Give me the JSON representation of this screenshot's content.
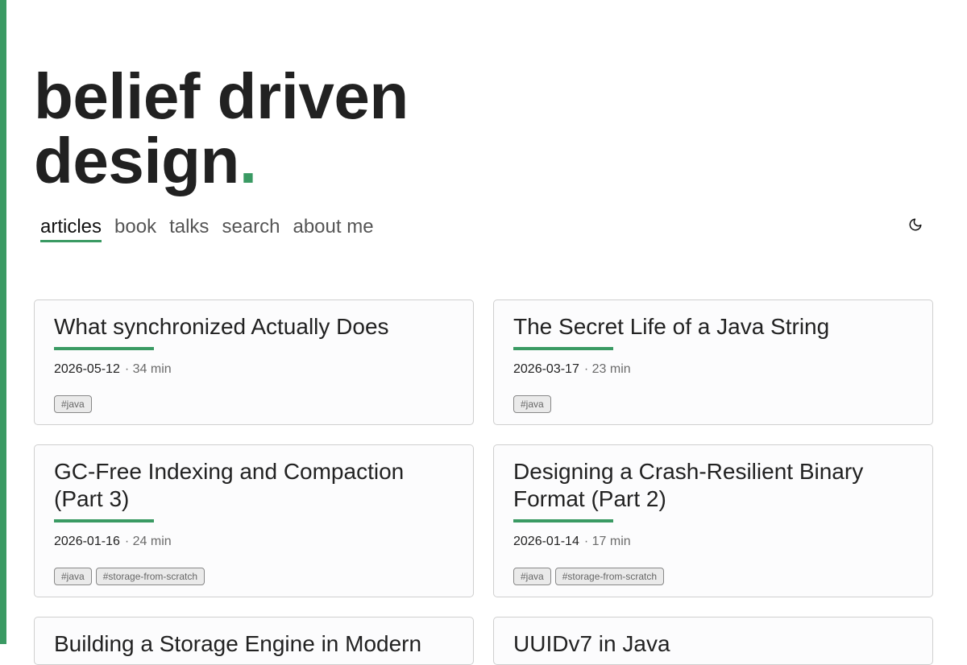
{
  "site": {
    "title_line1": "belief driven",
    "title_line2": "design",
    "title_dot": ".",
    "accent_color": "#3a9a63"
  },
  "nav": {
    "items": [
      {
        "label": "articles",
        "active": true
      },
      {
        "label": "book"
      },
      {
        "label": "talks"
      },
      {
        "label": "search"
      },
      {
        "label": "about me"
      }
    ],
    "theme_toggle_icon": "moon-icon"
  },
  "articles": [
    {
      "title": "What synchronized Actually Does",
      "date": "2026-05-12",
      "duration": "· 34 min",
      "tags": [
        "#java"
      ]
    },
    {
      "title": "The Secret Life of a Java String",
      "date": "2026-03-17",
      "duration": "· 23 min",
      "tags": [
        "#java"
      ]
    },
    {
      "title": "GC-Free Indexing and Compaction (Part 3)",
      "date": "2026-01-16",
      "duration": "· 24 min",
      "tags": [
        "#java",
        "#storage-from-scratch"
      ]
    },
    {
      "title": "Designing a Crash-Resilient Binary Format (Part 2)",
      "date": "2026-01-14",
      "duration": "· 17 min",
      "tags": [
        "#java",
        "#storage-from-scratch"
      ]
    },
    {
      "title": "Building a Storage Engine in Modern",
      "date": "",
      "duration": "",
      "tags": []
    },
    {
      "title": "UUIDv7 in Java",
      "date": "",
      "duration": "",
      "tags": []
    }
  ]
}
